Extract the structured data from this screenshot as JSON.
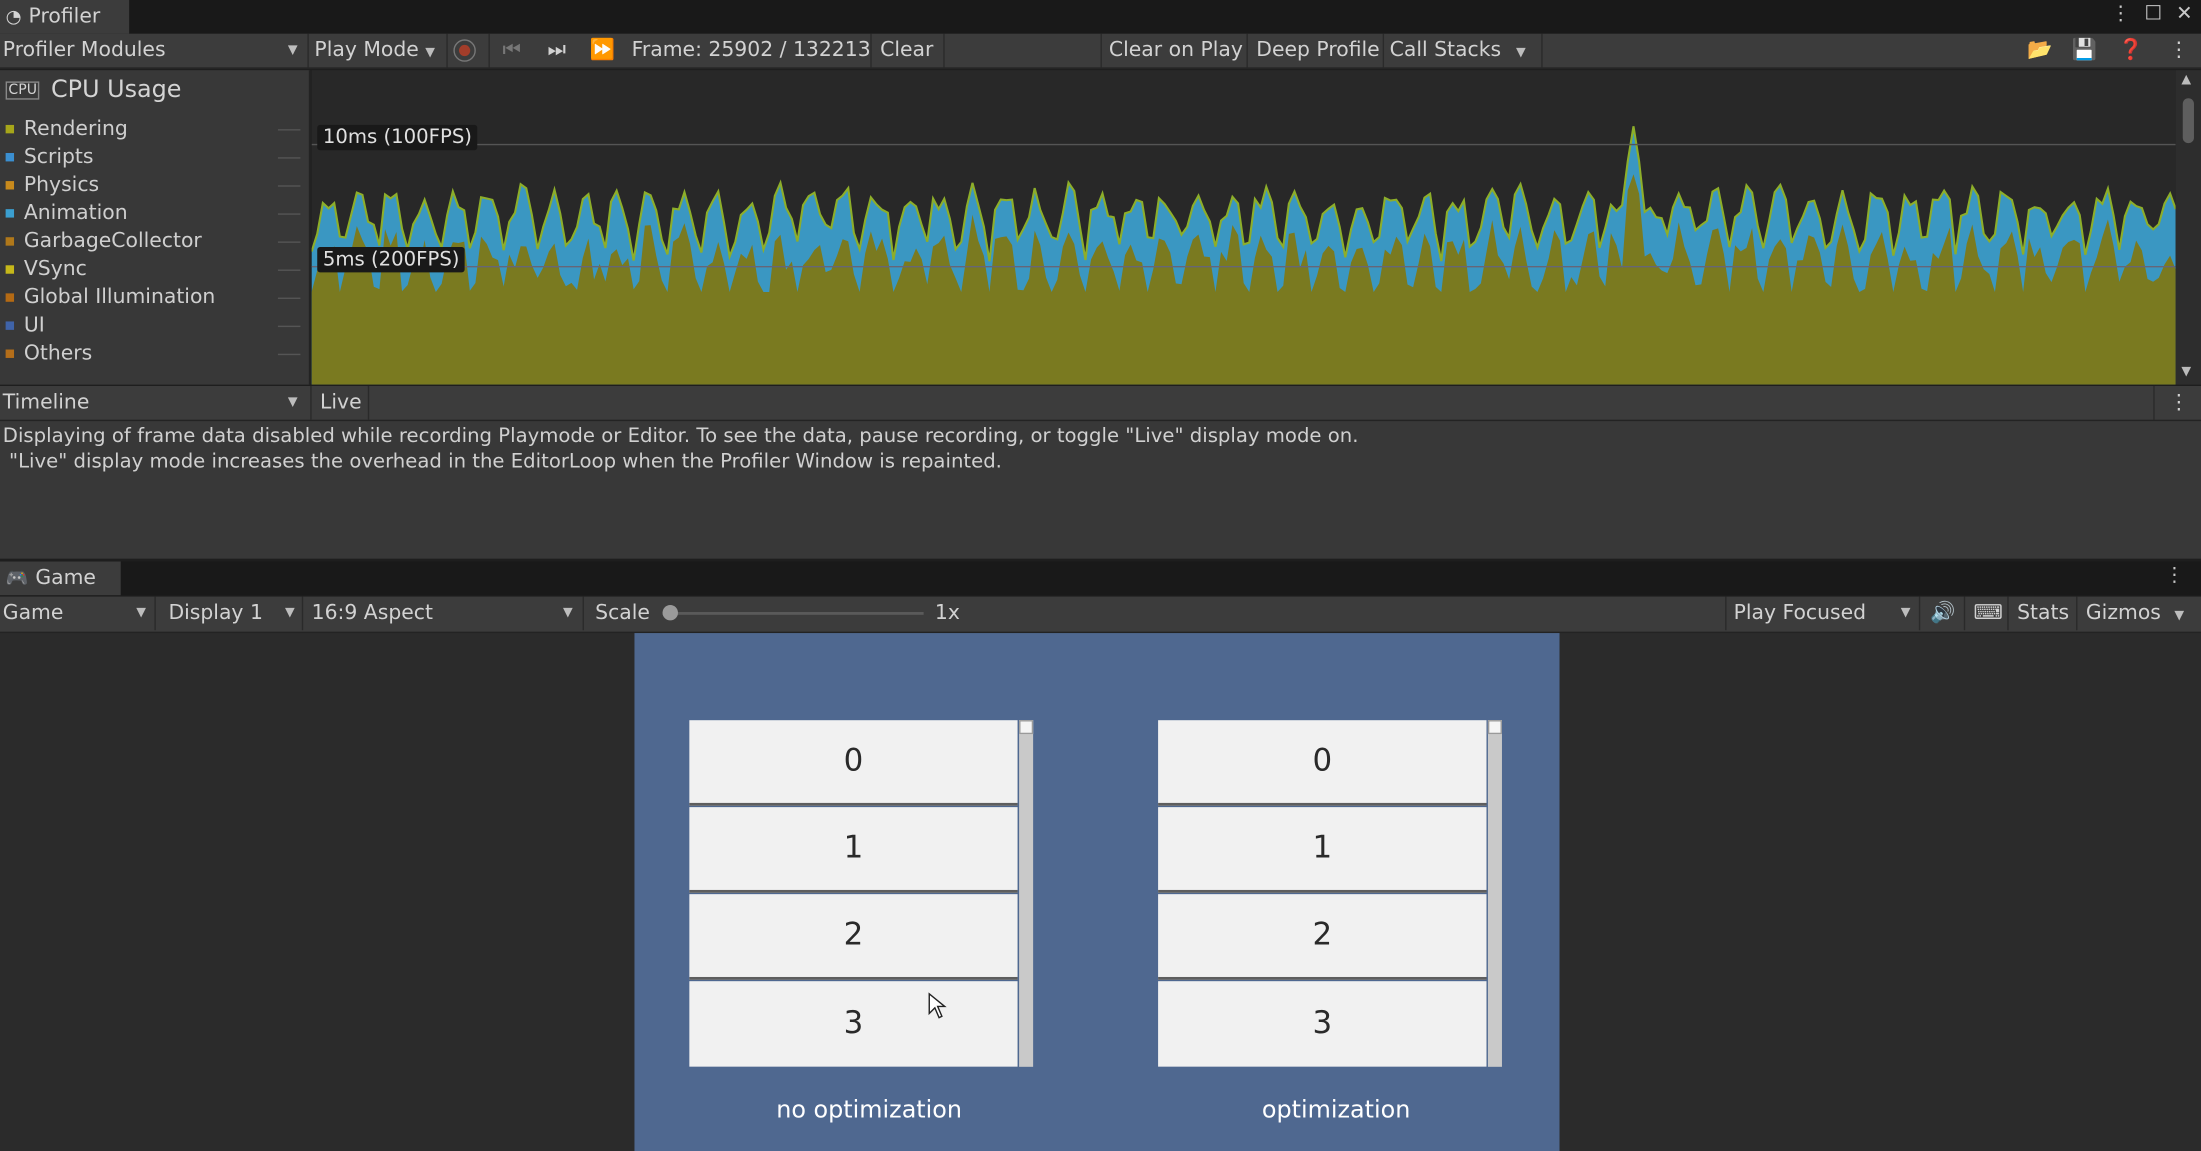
{
  "profiler": {
    "tab_title": "Profiler",
    "toolbar": {
      "modules": "Profiler Modules",
      "play_mode": "Play Mode",
      "frame": "Frame: 25902 / 132213",
      "clear": "Clear",
      "clear_on_play": "Clear on Play",
      "deep_profile": "Deep Profile",
      "call_stacks": "Call Stacks"
    },
    "cpu": {
      "title": "CPU Usage",
      "legend": [
        {
          "label": "Rendering",
          "color": "#a6a61a"
        },
        {
          "label": "Scripts",
          "color": "#3b8fd0"
        },
        {
          "label": "Physics",
          "color": "#c88a1c"
        },
        {
          "label": "Animation",
          "color": "#3b9fd0"
        },
        {
          "label": "GarbageCollector",
          "color": "#b0781a"
        },
        {
          "label": "VSync",
          "color": "#c6b81a"
        },
        {
          "label": "Global Illumination",
          "color": "#b46a14"
        },
        {
          "label": "UI",
          "color": "#3f63a8"
        },
        {
          "label": "Others",
          "color": "#b46e1a"
        }
      ],
      "label_10ms": "10ms (100FPS)",
      "label_5ms": "5ms (200FPS)"
    },
    "timeline": {
      "mode": "Timeline",
      "live": "Live",
      "message_line1": "Displaying of frame data disabled while recording Playmode or Editor. To see the data, pause recording, or toggle \"Live\" display mode on.",
      "message_line2": " \"Live\" display mode increases the overhead in the EditorLoop when the Profiler Window is repainted."
    }
  },
  "game": {
    "tab_title": "Game",
    "toolbar": {
      "view": "Game",
      "display": "Display 1",
      "aspect": "16:9 Aspect",
      "scale_label": "Scale",
      "scale_value": "1x",
      "play_focused": "Play Focused",
      "stats": "Stats",
      "gizmos": "Gizmos"
    },
    "lists": [
      {
        "items": [
          "0",
          "1",
          "2",
          "3"
        ],
        "caption": "no optimization"
      },
      {
        "items": [
          "0",
          "1",
          "2",
          "3"
        ],
        "caption": "optimization"
      }
    ]
  },
  "colors": {
    "graph_rendering": "#7a7a20",
    "graph_scripts": "#3a97c2",
    "graph_top": "#8dae2a",
    "canvas_bg": "#4f6890"
  }
}
